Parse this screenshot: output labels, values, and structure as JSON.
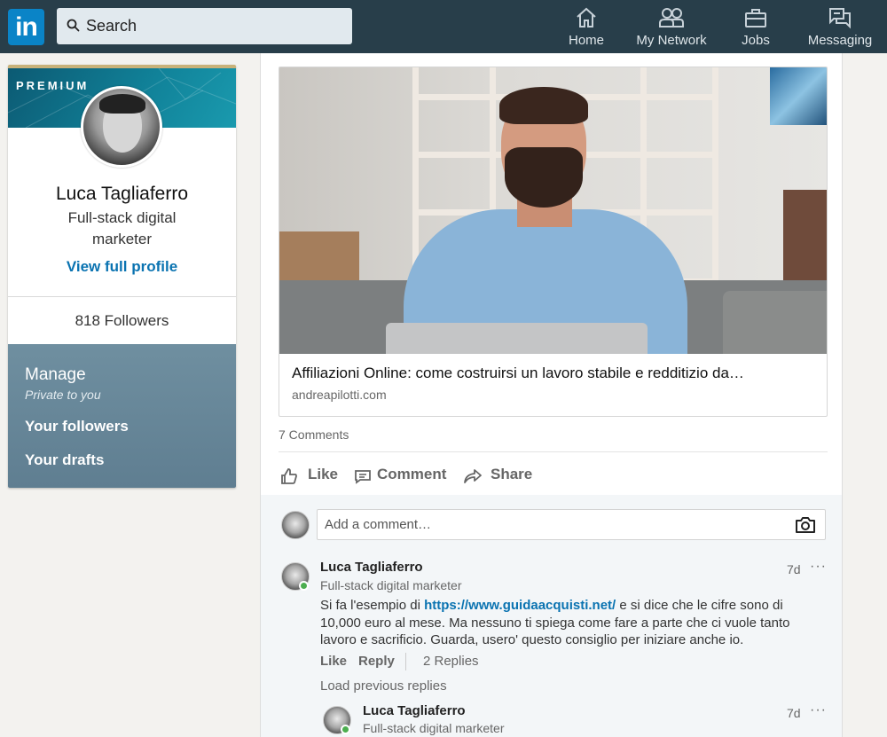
{
  "nav": {
    "search_placeholder": "Search",
    "items": [
      {
        "label": "Home",
        "icon": "home-icon"
      },
      {
        "label": "My Network",
        "icon": "network-icon"
      },
      {
        "label": "Jobs",
        "icon": "briefcase-icon"
      },
      {
        "label": "Messaging",
        "icon": "messaging-icon"
      }
    ]
  },
  "profile": {
    "badge": "PREMIUM",
    "name": "Luca Tagliaferro",
    "headline": "Full-stack digital marketer",
    "view_profile": "View full profile",
    "followers": "818 Followers",
    "manage_title": "Manage",
    "manage_subtitle": "Private to you",
    "link_followers": "Your followers",
    "link_drafts": "Your drafts"
  },
  "post": {
    "article_title": "Affiliazioni Online: come costruirsi un lavoro stabile e redditizio da…",
    "article_source": "andreapilotti.com",
    "comments_count": "7 Comments",
    "actions": {
      "like": "Like",
      "comment": "Comment",
      "share": "Share"
    }
  },
  "comments": {
    "add_placeholder": "Add a comment…",
    "first": {
      "author": "Luca Tagliaferro",
      "headline": "Full-stack digital marketer",
      "time": "7d",
      "more": "···",
      "text_before": "Si fa l'esempio di ",
      "link": "https://www.guidaacquisti.net/",
      "text_after": " e si dice che le cifre sono di 10,000 euro al mese. Ma nessuno ti spiega come fare a parte che ci vuole tanto lavoro e sacrificio. Guarda, usero' questo consiglio per iniziare anche io.",
      "like": "Like",
      "reply": "Reply",
      "replies": "2 Replies"
    },
    "load_previous": "Load previous replies",
    "reply1": {
      "author": "Luca Tagliaferro",
      "headline": "Full-stack digital marketer",
      "time": "7d",
      "more": "···"
    }
  },
  "colors": {
    "topbar": "#283e4a",
    "brand": "#0a84c7",
    "link": "#0a73b1",
    "online": "#4cae4f"
  }
}
